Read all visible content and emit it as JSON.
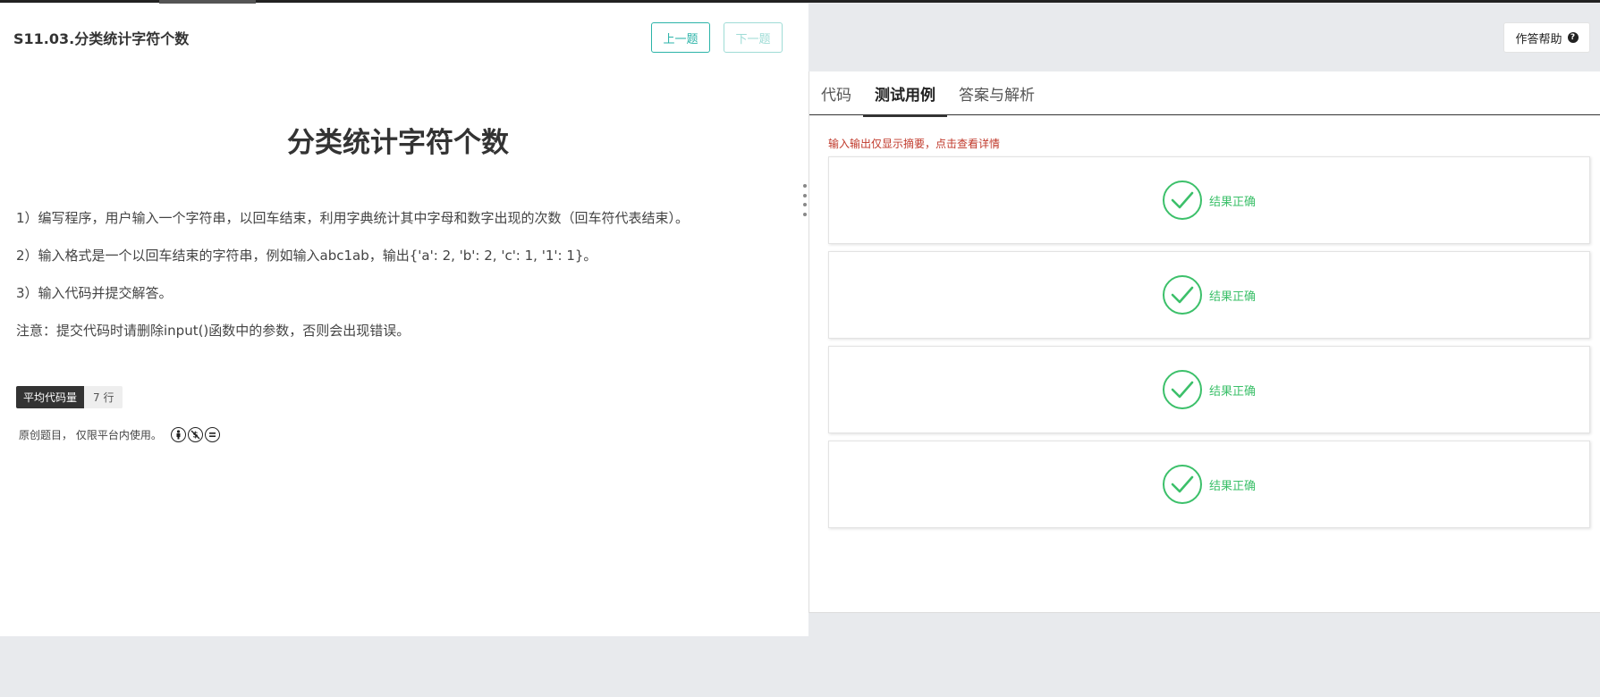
{
  "header": {
    "problem_code_title": "S11.03.分类统计字符个数",
    "prev_label": "上一题",
    "next_label": "下一题"
  },
  "problem": {
    "heading": "分类统计字符个数",
    "lines": [
      "1）编写程序，用户输入一个字符串，以回车结束，利用字典统计其中字母和数字出现的次数（回车符代表结束）。",
      "2）输入格式是一个以回车结束的字符串，例如输入abc1ab，输出{'a': 2, 'b': 2, 'c': 1, '1': 1}。",
      "3）输入代码并提交解答。",
      "注意：提交代码时请删除input()函数中的参数，否则会出现错误。"
    ],
    "badge_label": "平均代码量",
    "badge_value": "7 行",
    "copyright": "原创题目，  仅限平台内使用。"
  },
  "right": {
    "help_label": "作答帮助",
    "tabs": [
      {
        "label": "代码",
        "active": false
      },
      {
        "label": "测试用例",
        "active": true
      },
      {
        "label": "答案与解析",
        "active": false
      }
    ],
    "notice": "输入输出仅显示摘要，点击查看详情",
    "cases": [
      {
        "result": "结果正确"
      },
      {
        "result": "结果正确"
      },
      {
        "result": "结果正确"
      },
      {
        "result": "结果正确"
      }
    ]
  },
  "colors": {
    "accent": "#2bb3a8",
    "success": "#3cc06a",
    "notice": "#c0392b"
  }
}
